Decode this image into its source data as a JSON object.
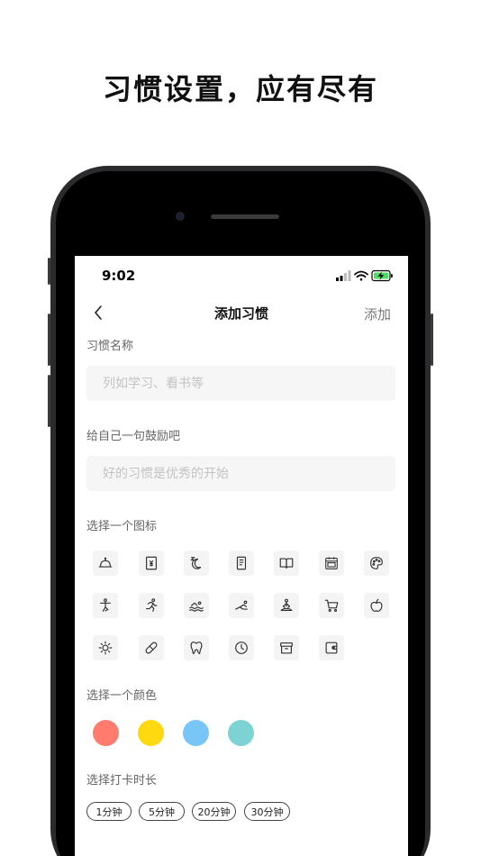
{
  "headline": "习惯设置，应有尽有",
  "status": {
    "time": "9:02"
  },
  "nav": {
    "title": "添加习惯",
    "action": "添加"
  },
  "form": {
    "name_label": "习惯名称",
    "name_placeholder": "列如学习、看书等",
    "motto_label": "给自己一句鼓励吧",
    "motto_placeholder": "好的习惯是优秀的开始",
    "icon_label": "选择一个图标",
    "color_label": "选择一个颜色",
    "duration_label": "选择打卡时长"
  },
  "icons": [
    "cloche-icon",
    "receipt-icon",
    "moon-sleep-icon",
    "scroll-icon",
    "open-book-icon",
    "calendar-icon",
    "palette-icon",
    "yoga-icon",
    "running-icon",
    "swimming-icon",
    "stretching-icon",
    "meditation-icon",
    "cart-icon",
    "apple-icon",
    "sun-icon",
    "pill-icon",
    "tooth-icon",
    "clock-icon",
    "box-icon",
    "wallet-icon"
  ],
  "colors": [
    "#FF7B6E",
    "#FFD90F",
    "#78C6F8",
    "#7DD3D3"
  ],
  "durations": [
    "1分钟",
    "5分钟",
    "20分钟",
    "30分钟"
  ]
}
